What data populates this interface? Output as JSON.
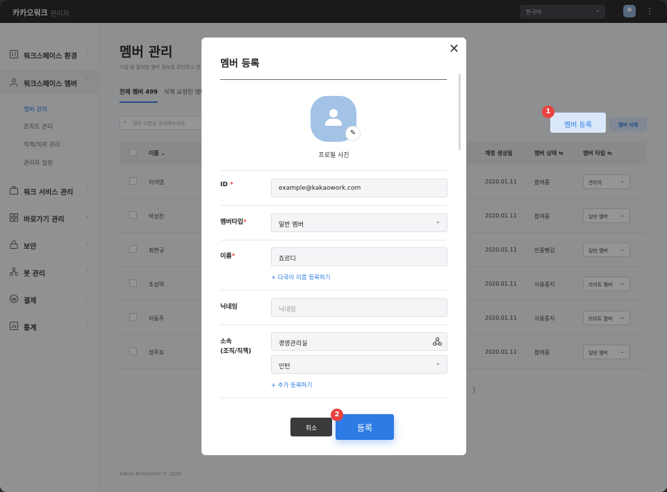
{
  "topbar": {
    "brand": "카카오워크",
    "brand_sub": "관리자",
    "language": "한국어"
  },
  "sidebar": {
    "items": [
      {
        "label": "워크스페이스 환경",
        "icon": "settings-sliders-icon"
      },
      {
        "label": "워크스페이스 멤버",
        "icon": "person-icon"
      },
      {
        "label": "워크 서비스 관리",
        "icon": "briefcase-icon"
      },
      {
        "label": "바로가기 관리",
        "icon": "grid-icon"
      },
      {
        "label": "보안",
        "icon": "lock-icon"
      },
      {
        "label": "봇 관리",
        "icon": "bot-icon"
      },
      {
        "label": "결제",
        "icon": "won-icon"
      },
      {
        "label": "통계",
        "icon": "chart-icon"
      }
    ],
    "subitems": [
      "멤버 관리",
      "조직도 관리",
      "직책/직위 관리",
      "관리자 설정"
    ]
  },
  "page": {
    "title": "멤버 관리",
    "desc": "가입 및 탈퇴한 멤버 정보를 확인하고 관",
    "tab_all": "전체 멤버 499",
    "tab_deleted": "삭제 요청된 멤버",
    "search_placeholder": "멤버 이름을 검색해보세요.",
    "register_button": "멤버 등록",
    "delete_button": "멤버 삭제",
    "footer": "Kakao Enterprise © 2020",
    "pager": "〉"
  },
  "table": {
    "headers": {
      "name": "이름",
      "created": "계정 생성일",
      "status": "멤버 상태",
      "type": "멤버 타입"
    },
    "rows": [
      {
        "name": "이석영",
        "created": "2020.01.11",
        "status": "참여중",
        "type": "관리자"
      },
      {
        "name": "박성찬",
        "created": "2020.01.11",
        "status": "참여중",
        "type": "일반 멤버"
      },
      {
        "name": "최현규",
        "created": "2020.01.11",
        "status": "인증뺏김",
        "type": "일반 멤버"
      },
      {
        "name": "조성락",
        "created": "2020.01.11",
        "status": "사용중지",
        "type": "라이트 멤버"
      },
      {
        "name": "이동주",
        "created": "2020.01.11",
        "status": "사용중지",
        "type": "라이트 멤버"
      },
      {
        "name": "정주호",
        "created": "2020.01.11",
        "status": "참여중",
        "type": "일반 멤버"
      }
    ]
  },
  "badges": {
    "first": "1",
    "second": "2"
  },
  "modal": {
    "title": "멤버 등록",
    "profile_label": "프로필 사진",
    "id_label": "ID",
    "id_value": "example@kakaowork.com",
    "type_label": "멤버타입",
    "type_value": "일반 멤버",
    "name_label": "이름",
    "name_value": "죠르디",
    "multilang_link": "+ 다국어 이름 등록하기",
    "nickname_label": "닉네임",
    "nickname_placeholder": "닉네임",
    "org_label_1": "소속",
    "org_label_2": "(조직/직책)",
    "org_value": "경영관리실",
    "position_value": "인턴",
    "add_link": "+ 추가 등록하기",
    "cancel": "취소",
    "submit": "등록",
    "required_mark": "*"
  }
}
